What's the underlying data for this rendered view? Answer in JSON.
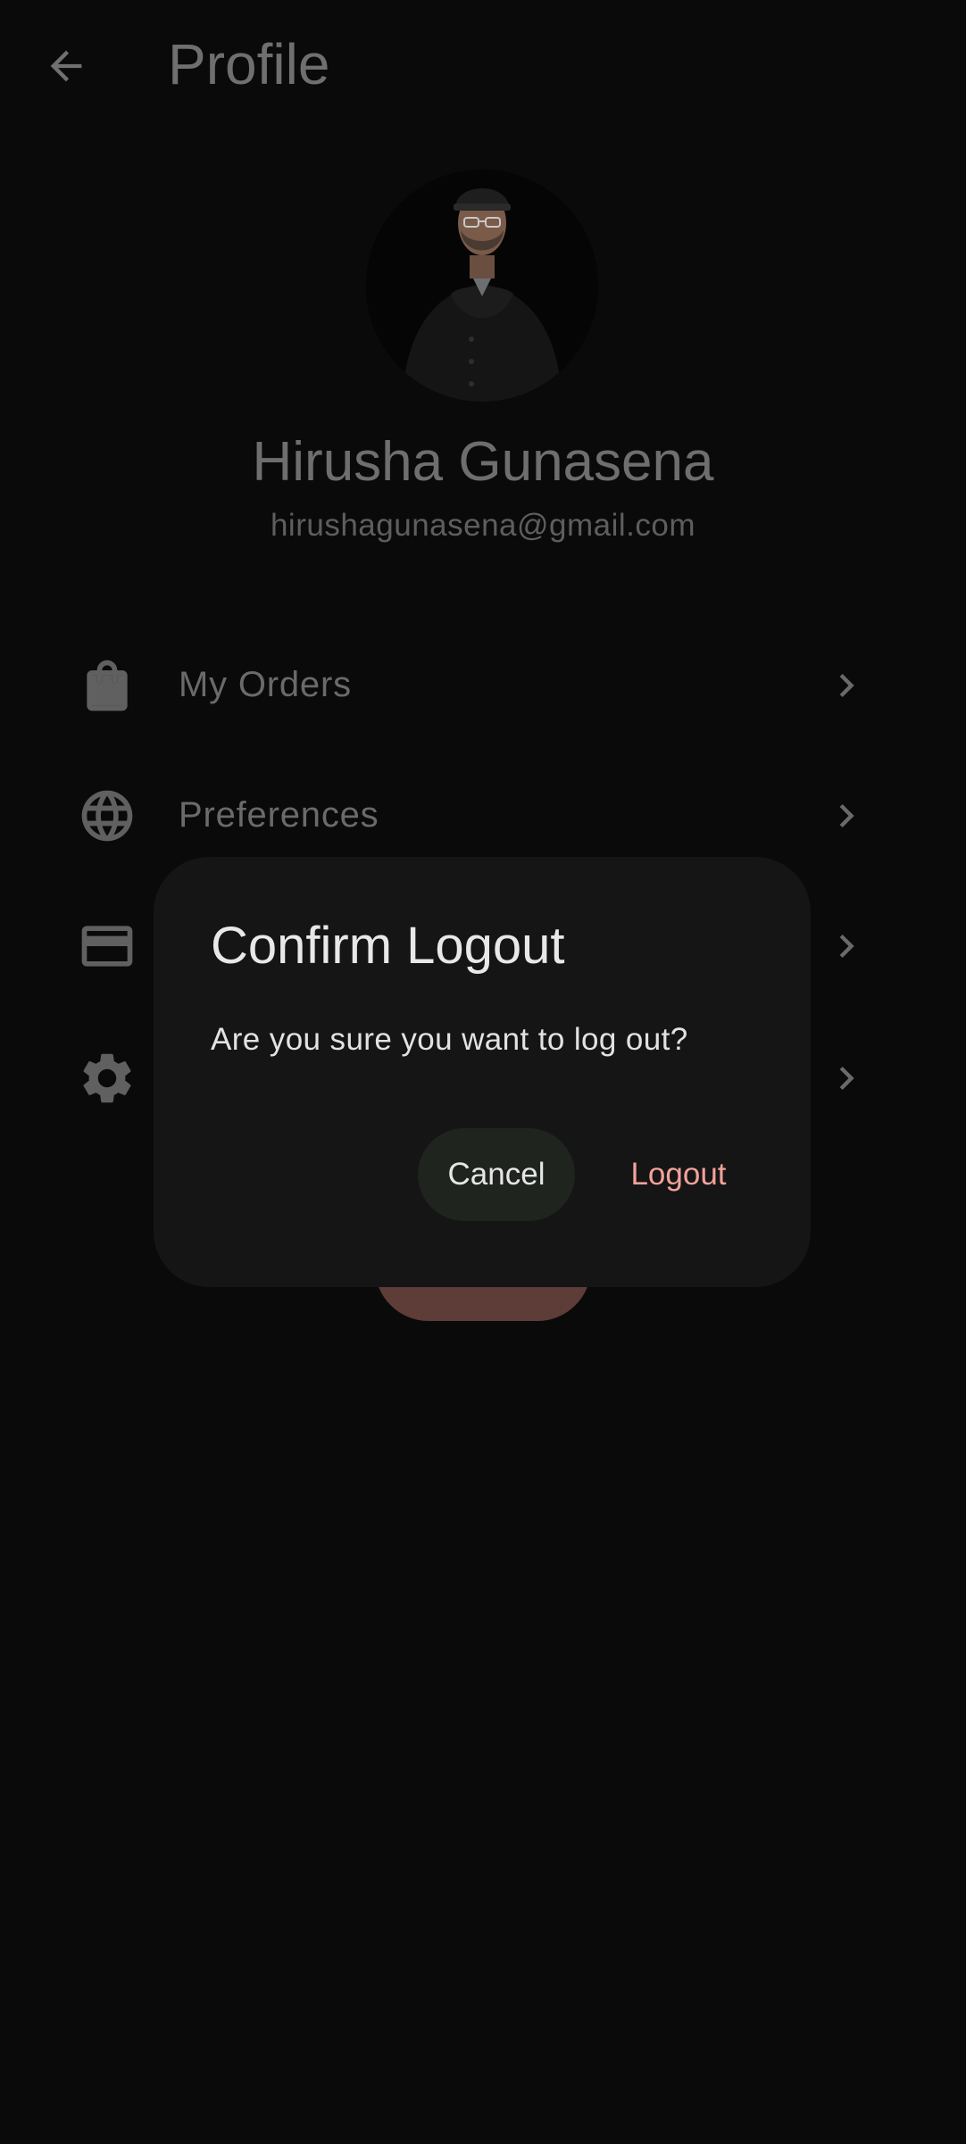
{
  "appbar": {
    "title": "Profile",
    "back_icon": "arrow-back-icon"
  },
  "profile": {
    "name": "Hirusha Gunasena",
    "email": "hirushagunasena@gmail.com"
  },
  "menu": {
    "items": [
      {
        "label": "My Orders",
        "icon": "shopping-bag-icon"
      },
      {
        "label": "Preferences",
        "icon": "globe-icon"
      },
      {
        "label": "",
        "icon": "credit-card-icon"
      },
      {
        "label": "",
        "icon": "gear-icon"
      }
    ],
    "chevron_icon": "chevron-right-icon"
  },
  "dialog": {
    "title": "Confirm Logout",
    "message": "Are you sure you want to log out?",
    "cancel_label": "Cancel",
    "confirm_label": "Logout"
  },
  "colors": {
    "background": "#0a0a0a",
    "dialog_background": "#151515",
    "logout_accent": "#f2a29a",
    "cancel_button": "#1f241f",
    "dimmed_logout_button": "#5e3c38"
  }
}
